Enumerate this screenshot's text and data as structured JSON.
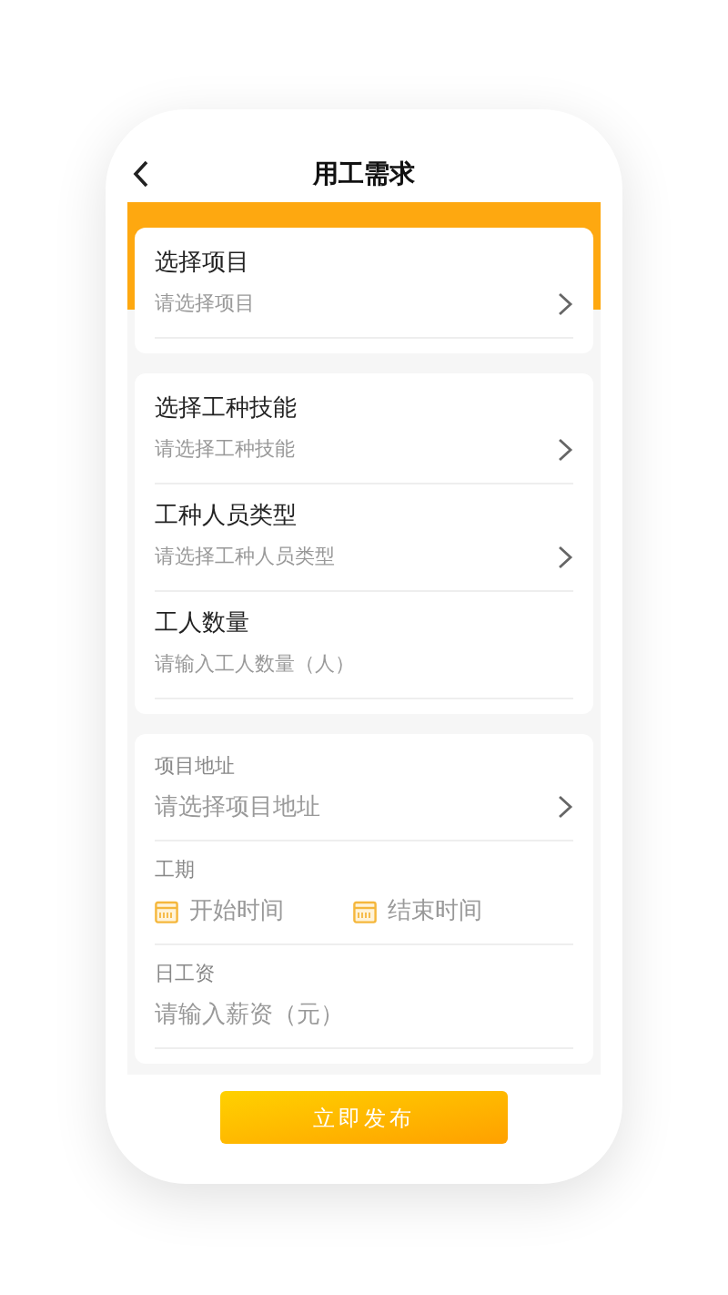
{
  "header": {
    "title": "用工需求"
  },
  "cards": [
    {
      "kind": "bold",
      "rows": [
        {
          "kind": "select",
          "label": "选择项目",
          "placeholder": "请选择项目"
        }
      ]
    },
    {
      "kind": "bold",
      "rows": [
        {
          "kind": "select",
          "label": "选择工种技能",
          "placeholder": "请选择工种技能"
        },
        {
          "kind": "select",
          "label": "工种人员类型",
          "placeholder": "请选择工种人员类型"
        },
        {
          "kind": "input",
          "label": "工人数量",
          "placeholder": "请输入工人数量（人）"
        }
      ]
    },
    {
      "kind": "light",
      "rows": [
        {
          "kind": "select",
          "label": "项目地址",
          "placeholder": "请选择项目地址"
        },
        {
          "kind": "dates",
          "label": "工期",
          "start": "开始时间",
          "end": "结束时间"
        },
        {
          "kind": "input",
          "label": "日工资",
          "placeholder": "请输入薪资（元）"
        }
      ]
    }
  ],
  "submit": {
    "label": "立即发布"
  }
}
